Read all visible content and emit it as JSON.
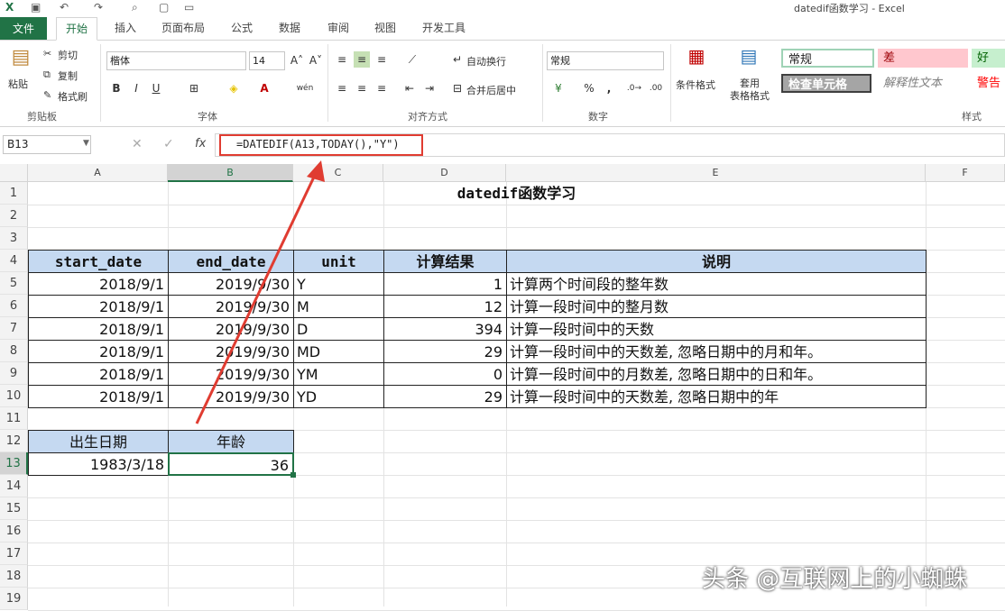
{
  "window": {
    "title": "datedif函数学习 - Excel"
  },
  "tabs": [
    "文件",
    "开始",
    "插入",
    "页面布局",
    "公式",
    "数据",
    "审阅",
    "视图",
    "开发工具"
  ],
  "ribbon": {
    "clipboard": {
      "paste": "粘贴",
      "cut": "剪切",
      "copy": "复制",
      "format_painter": "格式刷",
      "label": "剪贴板"
    },
    "font": {
      "name": "楷体",
      "size": "14",
      "bold": "B",
      "italic": "I",
      "underline": "U",
      "wen": "wén",
      "label": "字体"
    },
    "alignment": {
      "wrap": "自动换行",
      "merge": "合并后居中",
      "label": "对齐方式"
    },
    "number": {
      "format": "常规",
      "percent": "%",
      "comma": ",",
      "label": "数字"
    },
    "styles": {
      "conditional": "条件格式",
      "table_format": "套用\n表格格式",
      "label": "样式",
      "cells": [
        {
          "name": "常规",
          "bg": "#ffffff"
        },
        {
          "name": "差",
          "bg": "#ffc7ce"
        },
        {
          "name": "好",
          "bg": "#c6efce"
        },
        {
          "name": "检查单元格",
          "bg": "#a5a5a5"
        },
        {
          "name": "解释性文本",
          "bg": "#ffffff"
        },
        {
          "name": "警告",
          "bg": "#ffffff"
        }
      ]
    }
  },
  "formula_bar": {
    "name_box": "B13",
    "fx": "fx",
    "formula": "=DATEDIF(A13,TODAY(),\"Y\")"
  },
  "columns": [
    "A",
    "B",
    "C",
    "D",
    "E",
    "F"
  ],
  "rows": [
    "1",
    "2",
    "3",
    "4",
    "5",
    "6",
    "7",
    "8",
    "9",
    "10",
    "11",
    "12",
    "13",
    "14",
    "15",
    "16",
    "17",
    "18",
    "19"
  ],
  "sheet": {
    "title": "datedif函数学习",
    "headers": [
      "start_date",
      "end_date",
      "unit",
      "计算结果",
      "说明"
    ],
    "data": [
      [
        "2018/9/1",
        "2019/9/30",
        "Y",
        "1",
        "计算两个时间段的整年数"
      ],
      [
        "2018/9/1",
        "2019/9/30",
        "M",
        "12",
        "计算一段时间中的整月数"
      ],
      [
        "2018/9/1",
        "2019/9/30",
        "D",
        "394",
        "计算一段时间中的天数"
      ],
      [
        "2018/9/1",
        "2019/9/30",
        "MD",
        "29",
        "计算一段时间中的天数差, 忽略日期中的月和年。"
      ],
      [
        "2018/9/1",
        "2019/9/30",
        "YM",
        "0",
        "计算一段时间中的月数差, 忽略日期中的日和年。"
      ],
      [
        "2018/9/1",
        "2019/9/30",
        "YD",
        "29",
        " 计算一段时间中的天数差, 忽略日期中的年"
      ]
    ],
    "age_headers": [
      "出生日期",
      "年龄"
    ],
    "age_row": [
      "1983/3/18",
      "36"
    ]
  },
  "watermark": "头条 @互联网上的小蜘蛛",
  "colors": {
    "excel_green": "#217346",
    "header_fill": "#c5d9f1",
    "annotation_red": "#e03c31"
  }
}
